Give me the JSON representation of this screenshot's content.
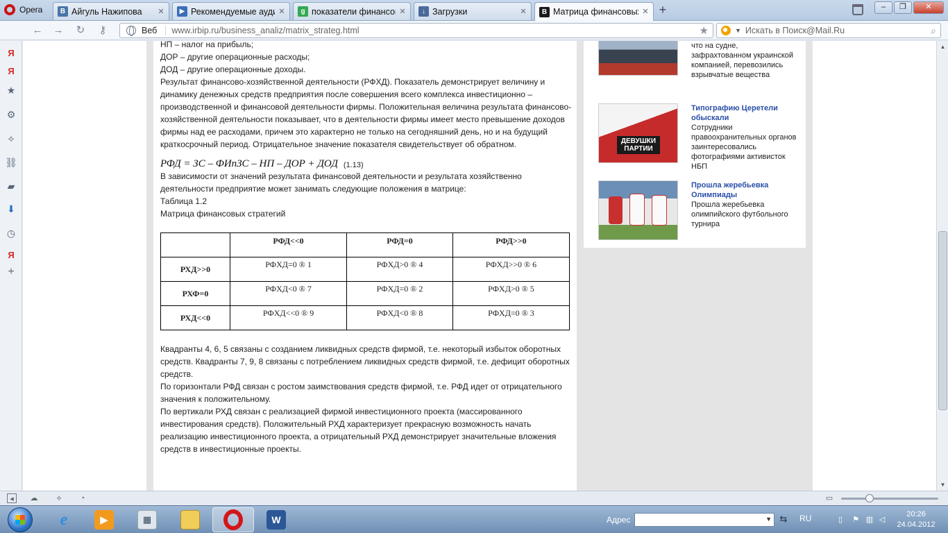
{
  "browser": {
    "menu_label": "Opera",
    "tabs": [
      {
        "label": "Айгуль Нажипова",
        "favicon": "vk-icon",
        "favicon_text": "В",
        "favicon_color": "#4a76a8"
      },
      {
        "label": "Рекомендуемые ауди...",
        "favicon": "video-icon",
        "favicon_text": "▶",
        "favicon_color": "#3b6fb6"
      },
      {
        "label": "показатели финансов...",
        "favicon": "google-icon",
        "favicon_text": "g",
        "favicon_color": "#34a853"
      },
      {
        "label": "Загрузки",
        "favicon": "download-icon",
        "favicon_text": "↓",
        "favicon_color": "#4a6b9a"
      },
      {
        "label": "Матрица финансовых...",
        "favicon": "irbip-icon",
        "favicon_text": "B",
        "favicon_color": "#1a1a1a"
      }
    ],
    "address": {
      "badge": "Веб",
      "url": "www.irbip.ru/business_analiz/matrix_strateg.html"
    },
    "search": {
      "placeholder": "Искать в Поиск@Mail.Ru"
    }
  },
  "article": {
    "lines_top": [
      "НП – налог на прибыль;",
      "ДОР – другие операционные расходы;",
      "ДОД – другие операционные доходы."
    ],
    "paragraph_rfhd": "Результат финансово-хозяйственной деятельности (РФХД). Показатель демонстрирует величину и динамику денежных средств предприятия после совершения всего комплекса инвестиционно – производственной и финансовой деятельности фирмы. Положительная величина результата финансово-хозяйственной деятельности показывает, что в деятельности фирмы имеет место превышение доходов фирмы над ее расходами, причем это характерно не только на сегодняшний день, но и на будущий краткосрочный период. Отрицательное значение показателя свидетельствует об обратном.",
    "formula": "РФД = ЗС – ФИпЗС – НП – ДОР + ДОД",
    "formula_number": "(1.13)",
    "paragraph_intro": "В зависимости от значений результата финансовой деятельности и результата хозяйственно деятельности предприятие может занимать следующие положения в матрице:",
    "table_number": "Таблица 1.2",
    "table_title": "Матрица финансовых стратегий",
    "table": {
      "headers": [
        "",
        "РФД<<0",
        "РФД=0",
        "РФД>>0"
      ],
      "rows": [
        [
          "РХД>>0",
          "РФХД=0 ® 1",
          "РФХД>0 ® 4",
          "РФХД>>0 ® 6"
        ],
        [
          "РХФ=0",
          "РФХД<0 ® 7",
          "РФХД=0 ® 2",
          "РФХД>0 ® 5"
        ],
        [
          "РХД<<0",
          "РФХД<<0 ® 9",
          "РФХД<0 ® 8",
          "РФХД=0 ® 3"
        ]
      ]
    },
    "paragraph_quadrants": "Квадранты 4, 6, 5 связаны с созданием ликвидных средств фирмой, т.е. некоторый избыток оборотных средств. Квадранты 7, 9, 8 связаны с потреблением ликвидных средств фирмой, т.е. дефицит оборотных средств.",
    "paragraph_horizontal": "По горизонтали РФД связан с ростом заимствования средств фирмой, т.е. РФД идет от отрицательного значения к положительному.",
    "paragraph_vertical": "По вертикали РХД связан с реализацией фирмой инвестиционного проекта (массированного инвестирования средств). Положительный РХД характеризует прекрасную возможность начать реализацию инвестиционного проекта, а отрицательный РХД демонстрирует значительные вложения средств в инвестиционные проекты."
  },
  "news": [
    {
      "title": "",
      "desc": "что на судне, зафрахтованном украинской компанией, перевозились взрывчатые вещества"
    },
    {
      "title": "Типографию Церетели обыскали",
      "desc": "Сотрудники правоохранительных органов заинтересовались фотографиями активисток НБП",
      "img_text": "ДЕВУШКИ ПАРТИИ"
    },
    {
      "title": "Прошла жеребьевка Олимпиады",
      "desc": "Прошла жеребьевка олимпийского футбольного турнира"
    }
  ],
  "taskbar": {
    "address_label": "Адрес",
    "language": "RU",
    "time": "20:26",
    "date": "24.04.2012"
  }
}
